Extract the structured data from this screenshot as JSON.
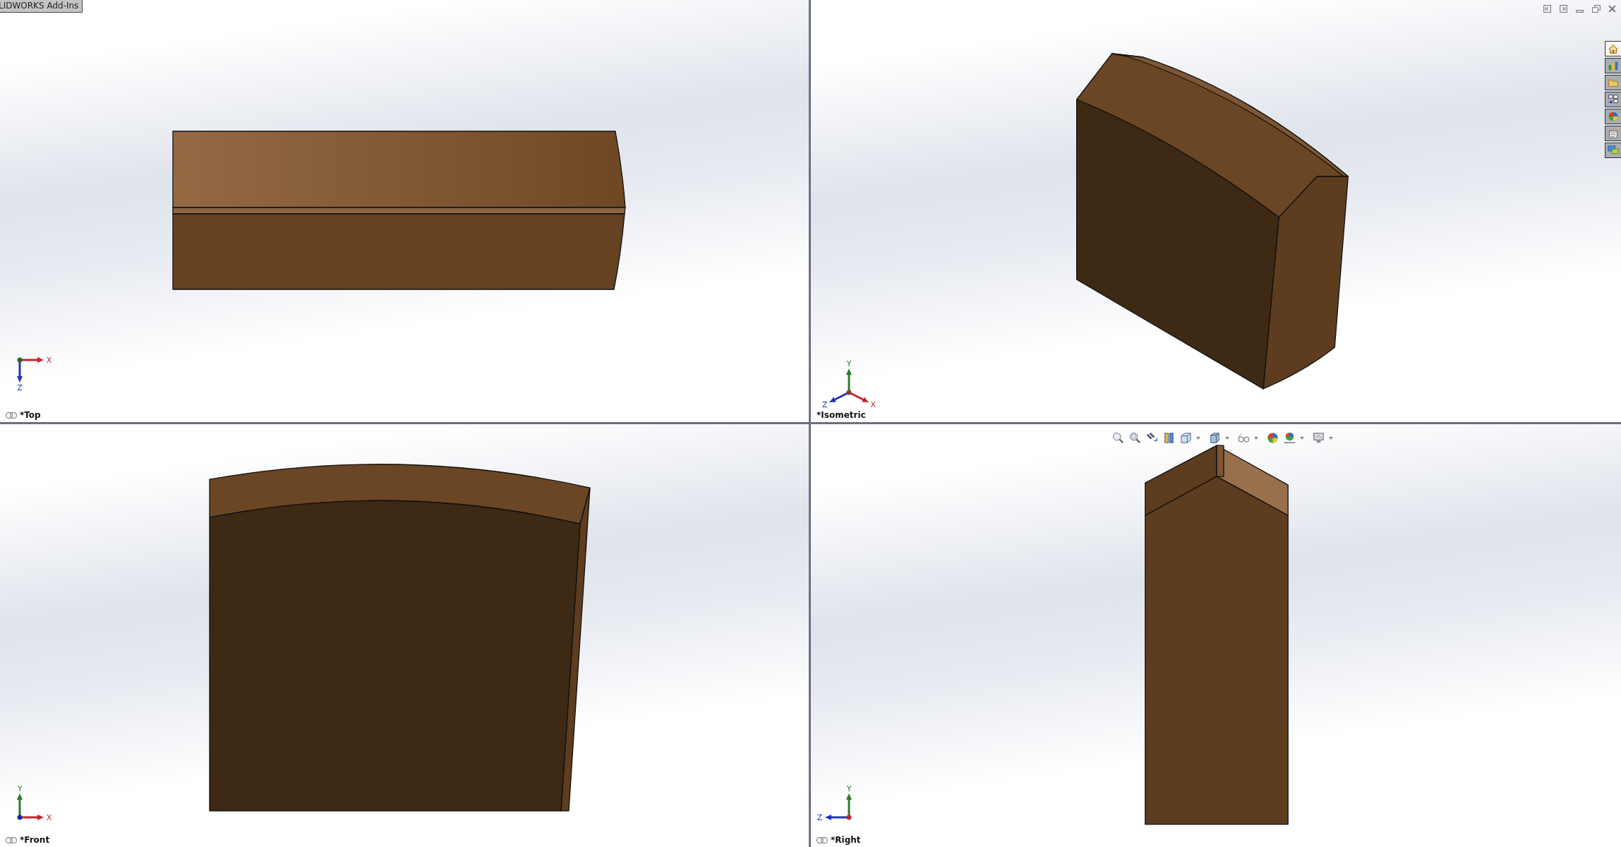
{
  "addins_tab": {
    "label": "LIDWORKS Add-Ins"
  },
  "window_controls": [
    {
      "kind": "tile-left"
    },
    {
      "kind": "tile-right"
    },
    {
      "kind": "minimize"
    },
    {
      "kind": "restore"
    },
    {
      "kind": "close"
    }
  ],
  "task_pane": [
    {
      "kind": "home",
      "selected": true
    },
    {
      "kind": "library",
      "selected": false
    },
    {
      "kind": "folder",
      "selected": false
    },
    {
      "kind": "palette",
      "selected": false
    },
    {
      "kind": "appearance",
      "selected": false
    },
    {
      "kind": "properties",
      "selected": false
    },
    {
      "kind": "forum",
      "selected": false
    }
  ],
  "heads_up_toolbar": [
    {
      "kind": "zoom-fit",
      "dropdown": false
    },
    {
      "kind": "zoom-area",
      "dropdown": false
    },
    {
      "kind": "previous-view",
      "dropdown": false
    },
    {
      "kind": "section",
      "dropdown": false
    },
    {
      "kind": "orientation",
      "dropdown": true
    },
    {
      "kind": "display-style",
      "dropdown": true
    },
    {
      "kind": "hide-show",
      "dropdown": true
    },
    {
      "kind": "appearance",
      "dropdown": false
    },
    {
      "kind": "scene",
      "dropdown": true
    },
    {
      "kind": "view-settings",
      "dropdown": true
    }
  ],
  "viewports": [
    {
      "kind": "top",
      "label": "*Top",
      "linked": true,
      "axes": [
        {
          "kind": "x",
          "label": "X"
        },
        {
          "kind": "z",
          "label": "Z"
        }
      ]
    },
    {
      "kind": "isometric",
      "label": "*Isometric",
      "linked": false,
      "axes": [
        {
          "kind": "y",
          "label": "Y"
        },
        {
          "kind": "z",
          "label": "Z"
        },
        {
          "kind": "x",
          "label": "X"
        }
      ]
    },
    {
      "kind": "front",
      "label": "*Front",
      "linked": true,
      "axes": [
        {
          "kind": "y",
          "label": "Y"
        },
        {
          "kind": "x",
          "label": "X"
        }
      ]
    },
    {
      "kind": "right",
      "label": "*Right",
      "linked": true,
      "axes": [
        {
          "kind": "y",
          "label": "Y"
        },
        {
          "kind": "z",
          "label": "Z"
        }
      ]
    }
  ]
}
